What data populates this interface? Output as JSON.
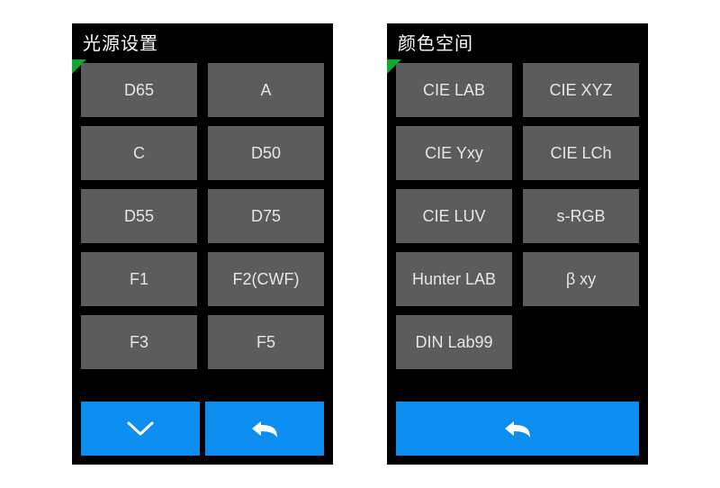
{
  "left_panel": {
    "title": "光源设置",
    "options": [
      "D65",
      "A",
      "C",
      "D50",
      "D55",
      "D75",
      "F1",
      "F2(CWF)",
      "F3",
      "F5"
    ],
    "buttons": {
      "down": "chevron-down",
      "back": "reply-arrow"
    }
  },
  "right_panel": {
    "title": "颜色空间",
    "options": [
      "CIE LAB",
      "CIE XYZ",
      "CIE Yxy",
      "CIE LCh",
      "CIE LUV",
      "s-RGB",
      "Hunter LAB",
      "β xy",
      "DIN Lab99"
    ],
    "buttons": {
      "back": "reply-arrow"
    }
  },
  "colors": {
    "accent": "#0b8ef0",
    "button_bg": "#5c5c5c",
    "marker": "#0fa82e",
    "panel": "#000000"
  }
}
